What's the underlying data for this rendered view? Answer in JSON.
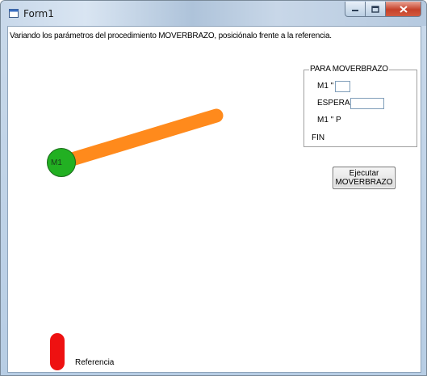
{
  "window": {
    "title": "Form1",
    "icons": {
      "app": "form-icon",
      "minimize": "minimize-icon",
      "maximize": "maximize-icon",
      "close": "close-icon"
    }
  },
  "instructions": "Variando los parámetros del procedimiento MOVERBRAZO, posiciónalo frente a la referencia.",
  "panel": {
    "title": "PARA MOVERBRAZO",
    "m1_label": "M1 \"",
    "m1_value": "",
    "espera_label": "ESPERA",
    "espera_value": "",
    "m1p_label": "M1 \" P",
    "fin_label": "FIN"
  },
  "execute_button": {
    "line1": "Ejecutar",
    "line2": "MOVERBRAZO"
  },
  "robot": {
    "motor_label": "M1",
    "motor_color": "#22b022",
    "arm_color": "#ff8a1c"
  },
  "reference": {
    "label": "Referencia",
    "color": "#ee1111"
  }
}
